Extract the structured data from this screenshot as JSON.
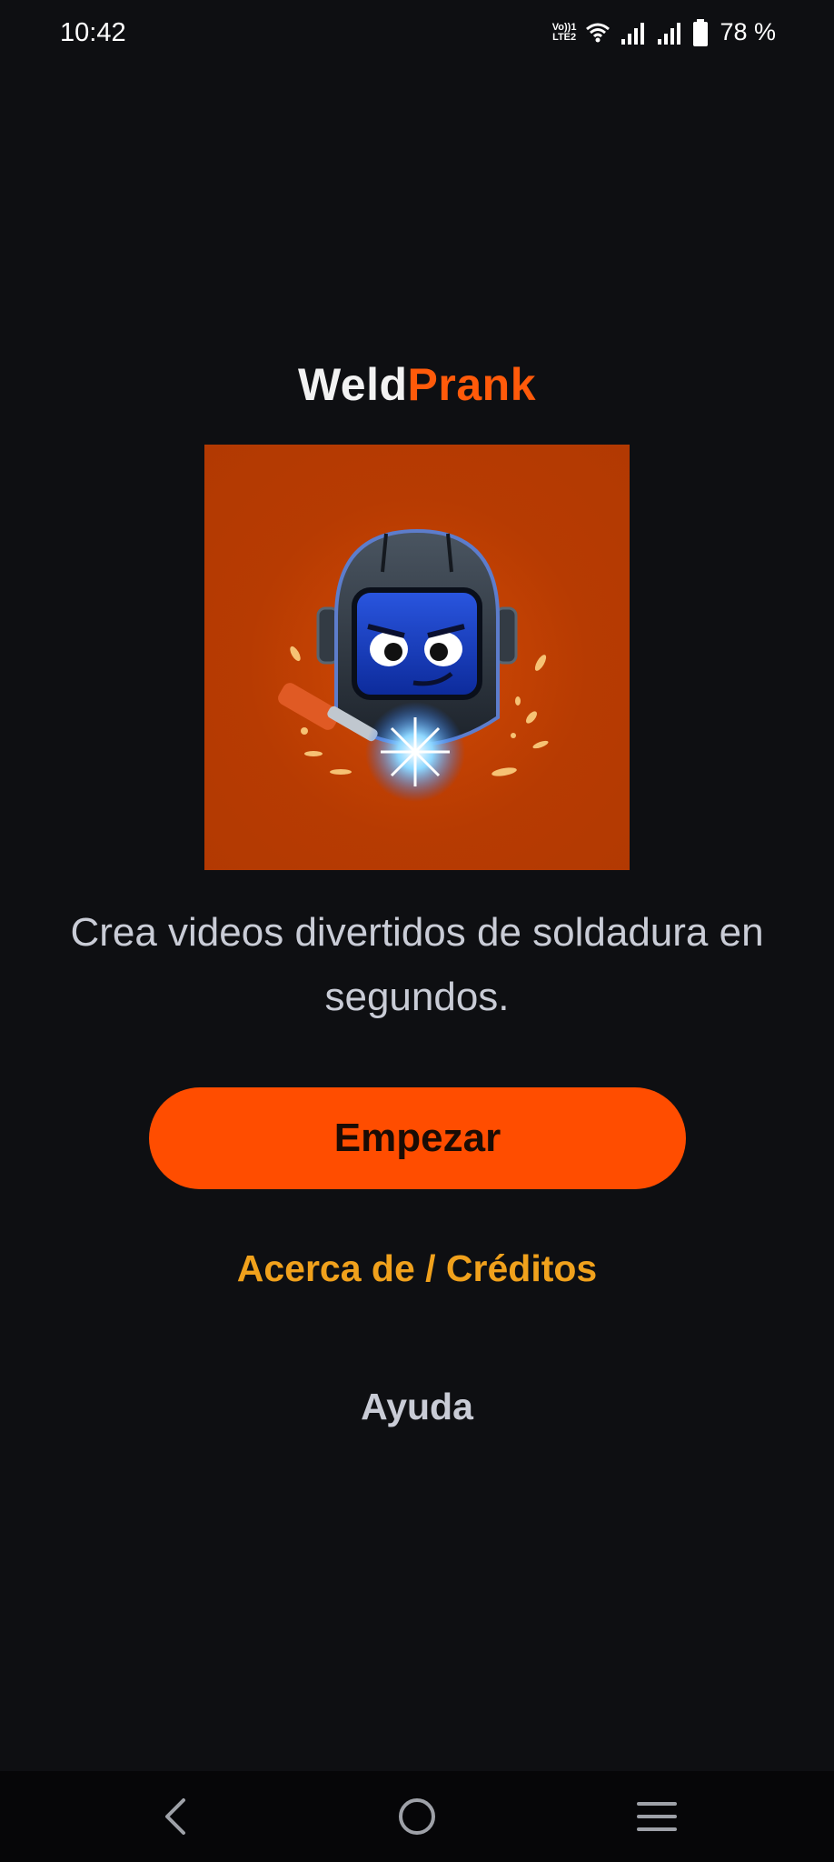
{
  "status_bar": {
    "time": "10:42",
    "network_label_top": "Vo))1",
    "network_label_bottom": "LTE2",
    "battery": "78 %"
  },
  "app": {
    "title_part1": "Weld",
    "title_part2": "Prank",
    "logo_icon": "welder-mascot-icon",
    "tagline": "Crea videos divertidos de soldadura en segundos.",
    "start_label": "Empezar",
    "about_label": "Acerca de / Créditos",
    "help_label": "Ayuda"
  },
  "colors": {
    "background": "#0e0f12",
    "accent": "#ff4d00",
    "link": "#f0a11c",
    "logo_bg": "#b73b02"
  },
  "nav": {
    "back_icon": "back-icon",
    "home_icon": "home-icon",
    "menu_icon": "menu-icon"
  }
}
